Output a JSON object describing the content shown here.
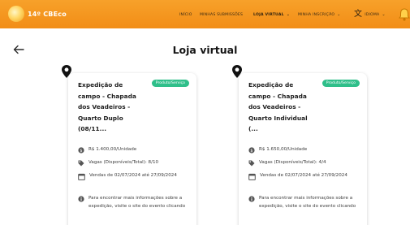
{
  "header": {
    "logo_text": "14º CBEco",
    "nav": {
      "inicio": "INÍCIO",
      "minhas_submissoes": "MINHAS SUBMISSÕES",
      "loja_virtual": "LOJA VIRTUAL",
      "minha_inscricao": "MINHA INSCRIÇÃO",
      "idioma": "IDIOMA"
    }
  },
  "page": {
    "title": "Loja virtual"
  },
  "products": [
    {
      "badge": "Produto/Serviço",
      "title": "Expedição de campo - Chapada dos Veadeiros - Quarto Duplo (08/11...",
      "price": "R$ 1.400,00/Unidade",
      "vagas": "Vagas (Disponíveis/Total): 8/10",
      "vendas": "Vendas de 02/07/2024 até 27/09/2024",
      "info": "Para encontrar mais informações sobre a expedição, visite o site do evento clicando"
    },
    {
      "badge": "Produto/Serviço",
      "title": "Expedição de campo - Chapada dos Veadeiros - Quarto Individual (...",
      "price": "R$ 1.650,00/Unidade",
      "vagas": "Vagas (Disponíveis/Total): 4/4",
      "vendas": "Vendas de 02/07/2024 até 27/09/2024",
      "info": "Para encontrar mais informações sobre a expedição, visite o site do evento clicando"
    }
  ],
  "colors": {
    "topbar": "#f49a20",
    "badge": "#2fbf8a",
    "title_text": "#151515"
  }
}
